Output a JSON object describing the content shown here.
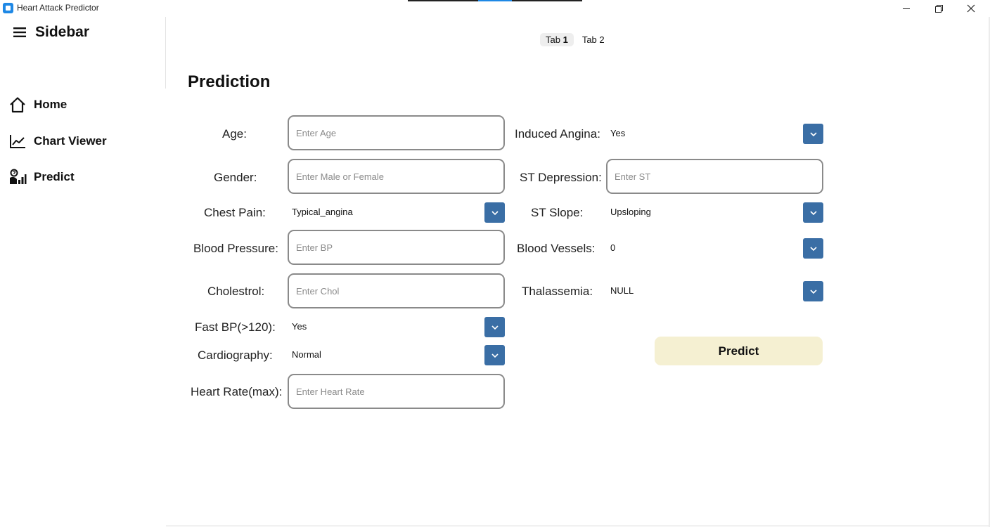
{
  "window": {
    "title": "Heart Attack Predictor",
    "minimize": "minimize",
    "maximize": "restore",
    "close": "close"
  },
  "sidebar": {
    "title": "Sidebar",
    "items": [
      {
        "label": "Home",
        "icon": "home-icon"
      },
      {
        "label": "Chart Viewer",
        "icon": "line-chart-icon"
      },
      {
        "label": "Predict",
        "icon": "predict-icon"
      }
    ]
  },
  "tabs": [
    {
      "label": "Tab",
      "num": "1",
      "active": true
    },
    {
      "label": "Tab 2",
      "active": false
    }
  ],
  "main": {
    "title": "Prediction",
    "fields": {
      "age": {
        "label": "Age:",
        "placeholder": "Enter Age"
      },
      "gender": {
        "label": "Gender:",
        "placeholder": "Enter Male or Female"
      },
      "chest_pain": {
        "label": "Chest Pain:",
        "value": "Typical_angina"
      },
      "blood_pressure": {
        "label": "Blood Pressure:",
        "placeholder": "Enter BP"
      },
      "cholestrol": {
        "label": "Cholestrol:",
        "placeholder": "Enter Chol"
      },
      "fast_bp": {
        "label": "Fast BP(>120):",
        "value": "Yes"
      },
      "cardiography": {
        "label": "Cardiography:",
        "value": "Normal"
      },
      "heart_rate": {
        "label": "Heart Rate(max):",
        "placeholder": "Enter Heart Rate"
      },
      "induced_angina": {
        "label": "Induced Angina:",
        "value": "Yes"
      },
      "st_depression": {
        "label": "ST Depression:",
        "placeholder": "Enter ST"
      },
      "st_slope": {
        "label": "ST Slope:",
        "value": "Upsloping"
      },
      "blood_vessels": {
        "label": "Blood Vessels:",
        "value": "0"
      },
      "thalassemia": {
        "label": "Thalassemia:",
        "value": "NULL"
      }
    },
    "predict_label": "Predict"
  },
  "colors": {
    "accent": "#3a6ea5",
    "predict_button": "#f5f0d2",
    "app_icon": "#1e88e5"
  }
}
